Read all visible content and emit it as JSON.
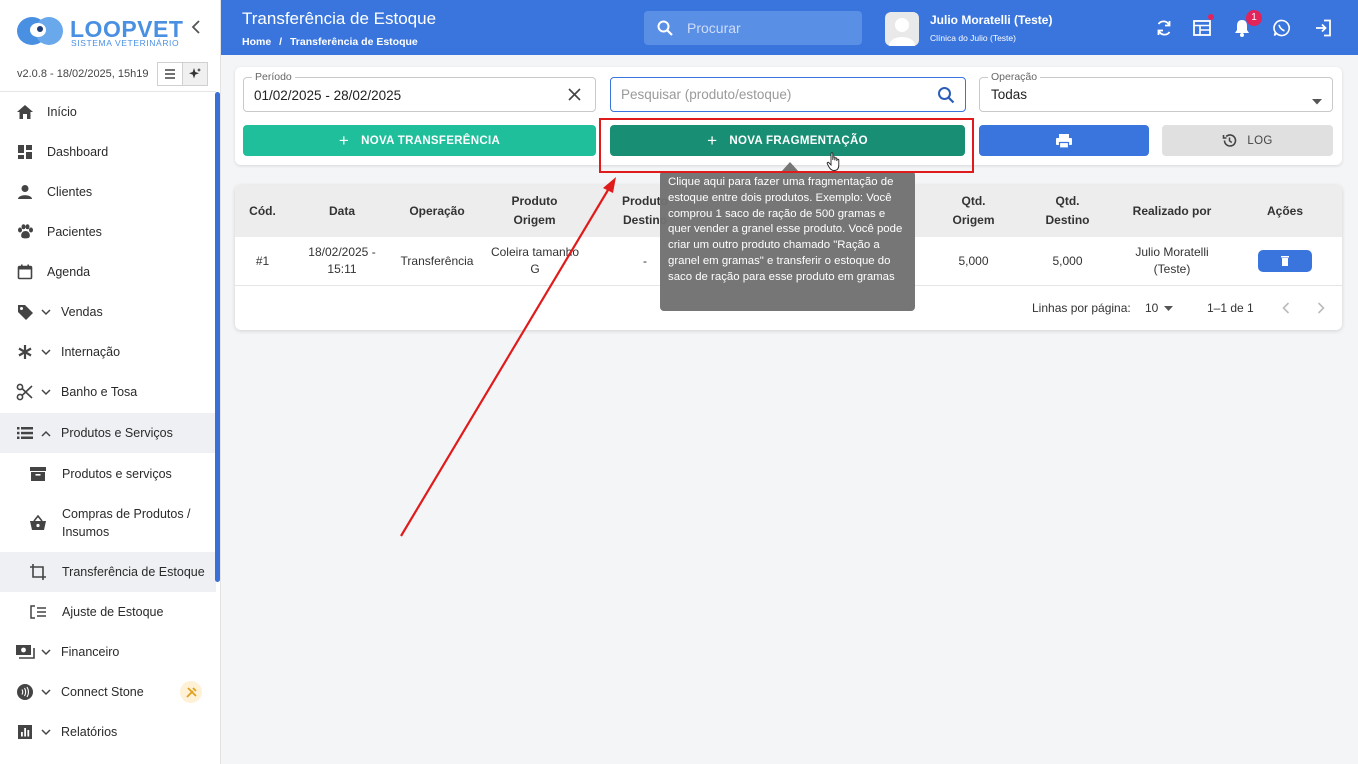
{
  "sidebar": {
    "brand": "LOOPVET",
    "brand_sub": "SISTEMA VETERINÁRIO",
    "version": "v2.0.8 - 18/02/2025, 15h19",
    "items": [
      {
        "label": "Início",
        "icon": "home-icon"
      },
      {
        "label": "Dashboard",
        "icon": "dashboard-icon"
      },
      {
        "label": "Clientes",
        "icon": "person-icon"
      },
      {
        "label": "Pacientes",
        "icon": "paw-icon"
      },
      {
        "label": "Agenda",
        "icon": "calendar-icon"
      },
      {
        "label": "Vendas",
        "icon": "tag-icon"
      },
      {
        "label": "Internação",
        "icon": "asterisk-icon"
      },
      {
        "label": "Banho e Tosa",
        "icon": "scissors-icon"
      },
      {
        "label": "Produtos e Serviços",
        "icon": "list-icon"
      },
      {
        "label": "Produtos e serviços",
        "icon": "archive-icon"
      },
      {
        "label": "Compras de Produtos / Insumos",
        "icon": "basket-icon"
      },
      {
        "label": "Transferência de Estoque",
        "icon": "crop-icon"
      },
      {
        "label": "Ajuste de Estoque",
        "icon": "list-adjust-icon"
      },
      {
        "label": "Financeiro",
        "icon": "money-icon"
      },
      {
        "label": "Connect Stone",
        "icon": "nfc-icon"
      },
      {
        "label": "Relatórios",
        "icon": "report-icon"
      }
    ]
  },
  "header": {
    "title": "Transferência de Estoque",
    "breadcrumb": {
      "home": "Home",
      "sep": "/",
      "current": "Transferência de Estoque"
    },
    "search_placeholder": "Procurar",
    "user_name": "Julio Moratelli (Teste)",
    "user_clinic": "Clínica do Julio (Teste)",
    "notification_count": "1"
  },
  "filters": {
    "period_label": "Período",
    "period_value": "01/02/2025 - 28/02/2025",
    "search_placeholder": "Pesquisar (produto/estoque)",
    "operation_label": "Operação",
    "operation_value": "Todas"
  },
  "buttons": {
    "new_transfer": "NOVA TRANSFERÊNCIA",
    "new_fragmentation": "NOVA FRAGMENTAÇÃO",
    "log": "LOG"
  },
  "table": {
    "headers": {
      "cod": "Cód.",
      "data": "Data",
      "operacao": "Operação",
      "produto_origem": "Produto Origem",
      "produto_destino": "Produto Destino",
      "qtd_origem": "Qtd. Origem",
      "qtd_destino": "Qtd. Destino",
      "realizado_por": "Realizado por",
      "acoes": "Ações"
    },
    "rows": [
      {
        "cod": "#1",
        "data": "18/02/2025 - 15:11",
        "operacao": "Transferência",
        "produto_origem": "Coleira tamanho G",
        "produto_destino": "-",
        "qtd_origem": "5,000",
        "qtd_destino": "5,000",
        "realizado_por": "Julio Moratelli (Teste)"
      }
    ],
    "pagination": {
      "rows_per_page_label": "Linhas por página:",
      "rows_per_page": "10",
      "range": "1–1 de 1"
    }
  },
  "tooltip": {
    "text": "Clique aqui para fazer uma fragmentação de estoque entre dois produtos. Exemplo: Você comprou 1 saco de ração de 500 gramas e quer vender a granel esse produto. Você pode criar um outro produto chamado \"Ração a granel em gramas\" e transferir o estoque do saco de ração para esse produto em gramas"
  },
  "colors": {
    "primary": "#3a75dd",
    "teal": "#1fbf9b",
    "teal_dark": "#188f74",
    "annotation_red": "#e01b1b"
  }
}
